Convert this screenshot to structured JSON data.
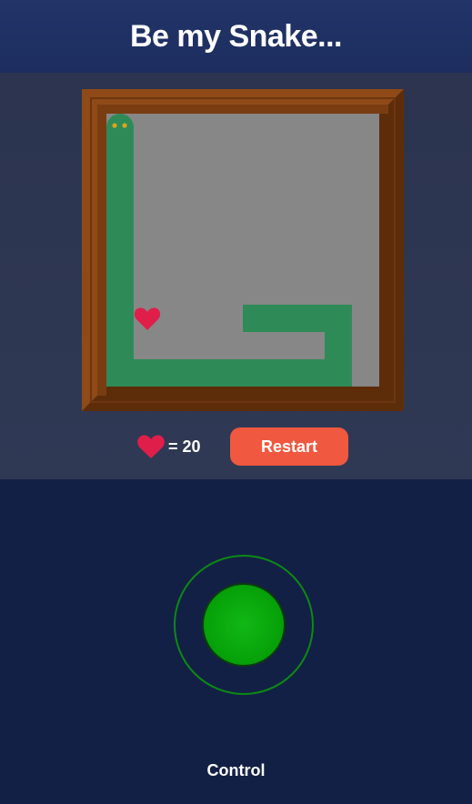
{
  "header": {
    "title": "Be my Snake..."
  },
  "board": {
    "colors": {
      "frame_light": "#8f4a17",
      "frame_dark": "#5d2d0a",
      "field": "#878787",
      "snake": "#2e8b57",
      "snake_eyes": "#d9a520",
      "food": "#e01e4a"
    },
    "food_icon": "heart-icon"
  },
  "status": {
    "score_icon": "heart-icon",
    "score_text": "= 20",
    "restart_label": "Restart"
  },
  "control": {
    "label": "Control",
    "colors": {
      "ring": "#0c8a12",
      "knob": "#07a30a"
    }
  }
}
